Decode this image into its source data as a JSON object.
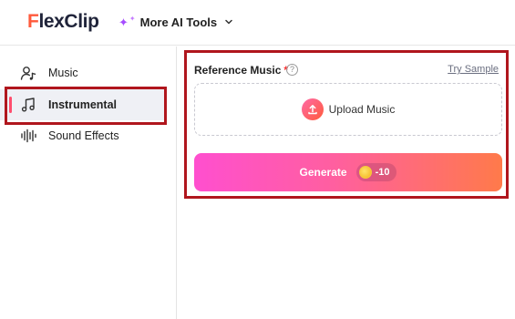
{
  "header": {
    "logo_first_letter": "F",
    "logo_rest": "lexClip",
    "ai_tools_label": "More AI Tools"
  },
  "sidebar": {
    "items": [
      {
        "label": "Music",
        "icon": "music-person-icon"
      },
      {
        "label": "Instrumental",
        "icon": "music-note-icon",
        "active": true
      },
      {
        "label": "Sound Effects",
        "icon": "sound-wave-icon"
      }
    ]
  },
  "panel": {
    "reference_label": "Reference Music",
    "required_marker": "*",
    "help_glyph": "?",
    "try_sample": "Try Sample",
    "upload_label": "Upload Music",
    "generate_label": "Generate",
    "credit_cost": "-10"
  },
  "colors": {
    "accent_red_outline": "#b0161d",
    "active_indicator": "#ff4d6d",
    "generate_gradient_start": "#ff4fcf",
    "generate_gradient_end": "#ff7a4a"
  }
}
